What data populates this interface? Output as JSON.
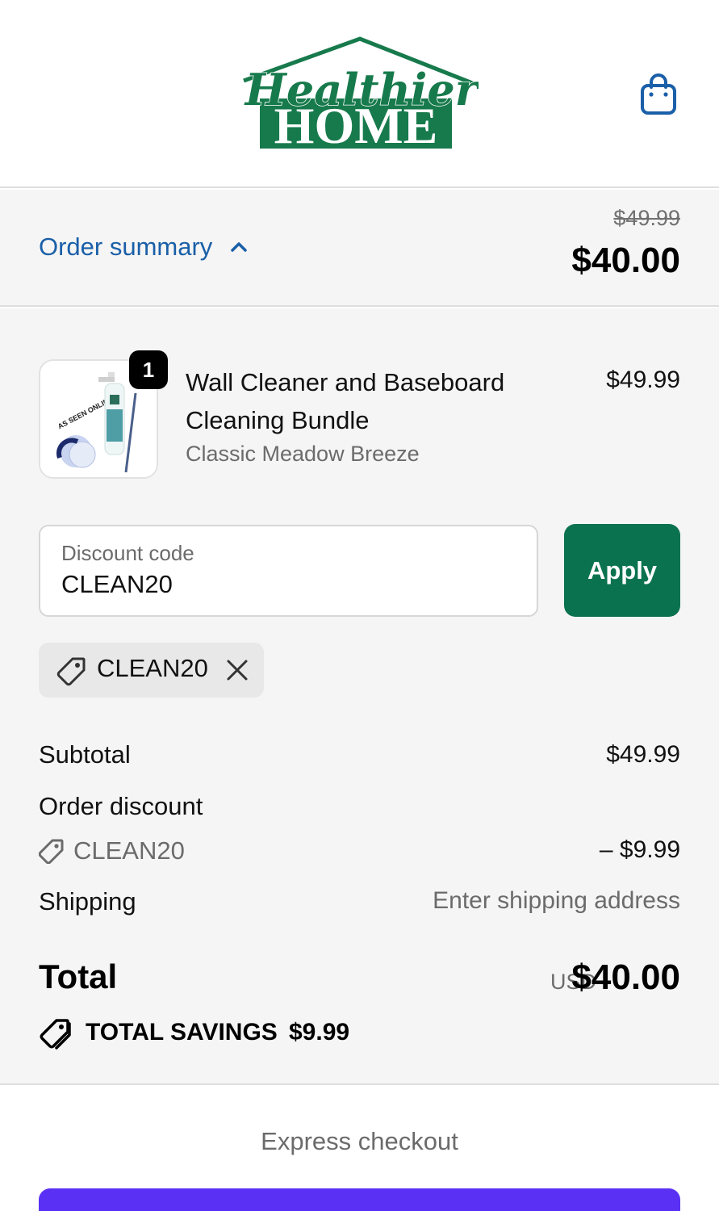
{
  "brand": {
    "logo_script": "Healthier",
    "logo_word": "HOME",
    "logo_color": "#177a4c"
  },
  "header": {
    "cart_icon": "shopping-bag-icon",
    "icon_color": "#1a5fa8"
  },
  "summary_bar": {
    "toggle_label": "Order summary",
    "compare_price": "$49.99",
    "current_price": "$40.00"
  },
  "line_item": {
    "quantity": "1",
    "name": "Wall Cleaner and Baseboard Cleaning Bundle",
    "variant": "Classic Meadow Breeze",
    "price": "$49.99",
    "image_text": "AS SEEN ONLINE"
  },
  "discount": {
    "placeholder": "Discount code",
    "value": "CLEAN20",
    "apply_label": "Apply",
    "applied_code": "CLEAN20",
    "apply_color": "#0b7250"
  },
  "totals": {
    "subtotal_label": "Subtotal",
    "subtotal_value": "$49.99",
    "order_discount_label": "Order discount",
    "discount_code": "CLEAN20",
    "discount_value": "– $9.99",
    "shipping_label": "Shipping",
    "shipping_value": "Enter shipping address",
    "total_label": "Total",
    "total_currency": "USD",
    "total_value": "$40.00",
    "savings_label": "TOTAL SAVINGS",
    "savings_value": "$9.99"
  },
  "express": {
    "label": "Express checkout",
    "button_color": "#5a31f4"
  }
}
